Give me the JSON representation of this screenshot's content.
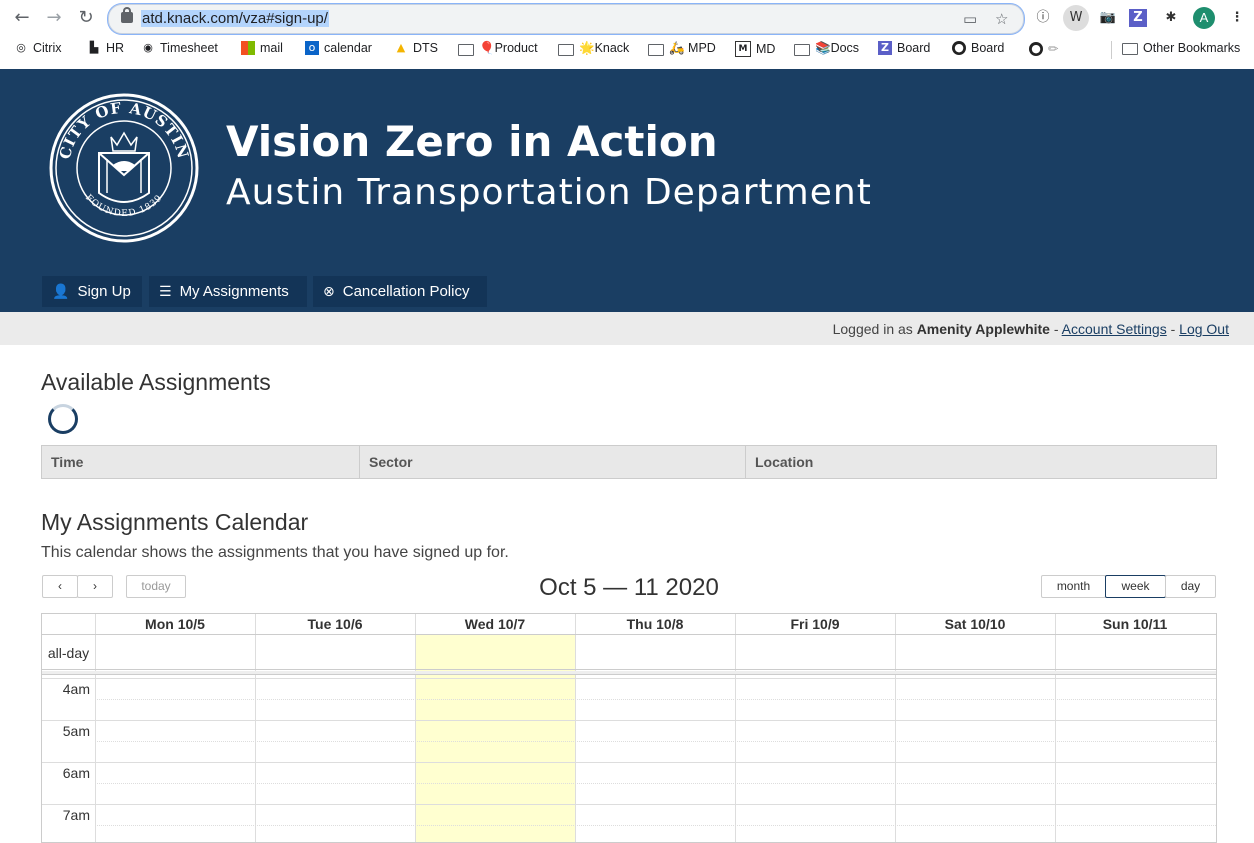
{
  "browser": {
    "url": "atd.knack.com/vza#sign-up/",
    "profile_initial": "A",
    "bookmarks": [
      {
        "label": "Citrix",
        "icon": "citrix-icon"
      },
      {
        "label": "HR",
        "icon": "building-icon"
      },
      {
        "label": "Timesheet",
        "icon": "globe-icon"
      },
      {
        "label": "mail",
        "icon": "microsoft-icon"
      },
      {
        "label": "calendar",
        "icon": "outlook-icon"
      },
      {
        "label": "DTS",
        "icon": "drive-icon"
      },
      {
        "label": "🎈Product",
        "icon": "folder-icon"
      },
      {
        "label": "🌟Knack",
        "icon": "folder-icon"
      },
      {
        "label": "🛵 MPD",
        "icon": "folder-icon"
      },
      {
        "label": "MD",
        "icon": "markdown-icon"
      },
      {
        "label": "📚Docs",
        "icon": "folder-icon"
      },
      {
        "label": "Board",
        "icon": "zenhub-icon"
      },
      {
        "label": "Board",
        "icon": "github-icon"
      },
      {
        "label": "✏",
        "icon": "github-icon"
      },
      {
        "label": "Other Bookmarks",
        "icon": "folder-icon"
      }
    ]
  },
  "header": {
    "title": "Vision Zero in Action",
    "subtitle": "Austin Transportation Department",
    "seal_text_top": "CITY OF AUSTIN",
    "seal_text_bottom": "FOUNDED 1839",
    "menu": [
      {
        "label": "Sign Up",
        "icon": "user-plus-icon"
      },
      {
        "label": "My Assignments",
        "icon": "list-icon"
      },
      {
        "label": "Cancellation Policy",
        "icon": "times-circle-icon"
      }
    ]
  },
  "account": {
    "prefix": "Logged in as",
    "user": "Amenity Applewhite",
    "sep": "-",
    "settings": "Account Settings",
    "logout": "Log Out"
  },
  "available": {
    "heading": "Available Assignments",
    "columns": [
      "Time",
      "Sector",
      "Location"
    ]
  },
  "calendar": {
    "heading": "My Assignments Calendar",
    "description": "This calendar shows the assignments that you have signed up for.",
    "prev": "‹",
    "next": "›",
    "today": "today",
    "range_title": "Oct 5 — 11 2020",
    "views": [
      "month",
      "week",
      "day"
    ],
    "active_view": "week",
    "days": [
      "Mon 10/5",
      "Tue 10/6",
      "Wed 10/7",
      "Thu 10/8",
      "Fri 10/9",
      "Sat 10/10",
      "Sun 10/11"
    ],
    "today_day": "Wed 10/7",
    "allday_label": "all-day",
    "times": [
      "4am",
      "5am",
      "6am",
      "7am"
    ],
    "colors": {
      "today_bg": "#ffffd0",
      "brand": "#1a3e63"
    }
  }
}
